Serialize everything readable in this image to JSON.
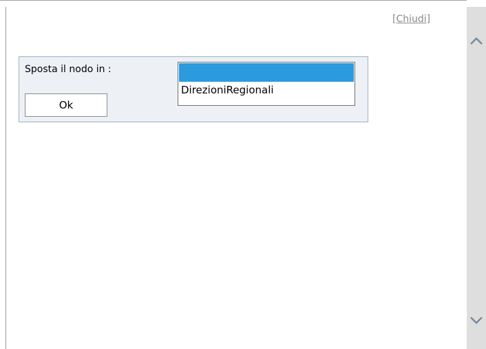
{
  "dialog": {
    "close_label": "[Chiudi]",
    "move_label": "Sposta il nodo in :",
    "ok_label": "Ok",
    "listbox": {
      "options": [
        "",
        "DirezioniRegionali"
      ],
      "selected_index": 0
    }
  },
  "icons": {
    "scroll_up": "chevron-up-icon",
    "scroll_down": "chevron-down-icon"
  },
  "colors": {
    "selection": "#2b9bdd",
    "panel_bg": "#edf1f6",
    "panel_border": "#9db0c8",
    "scrollbar": "#dedede"
  }
}
